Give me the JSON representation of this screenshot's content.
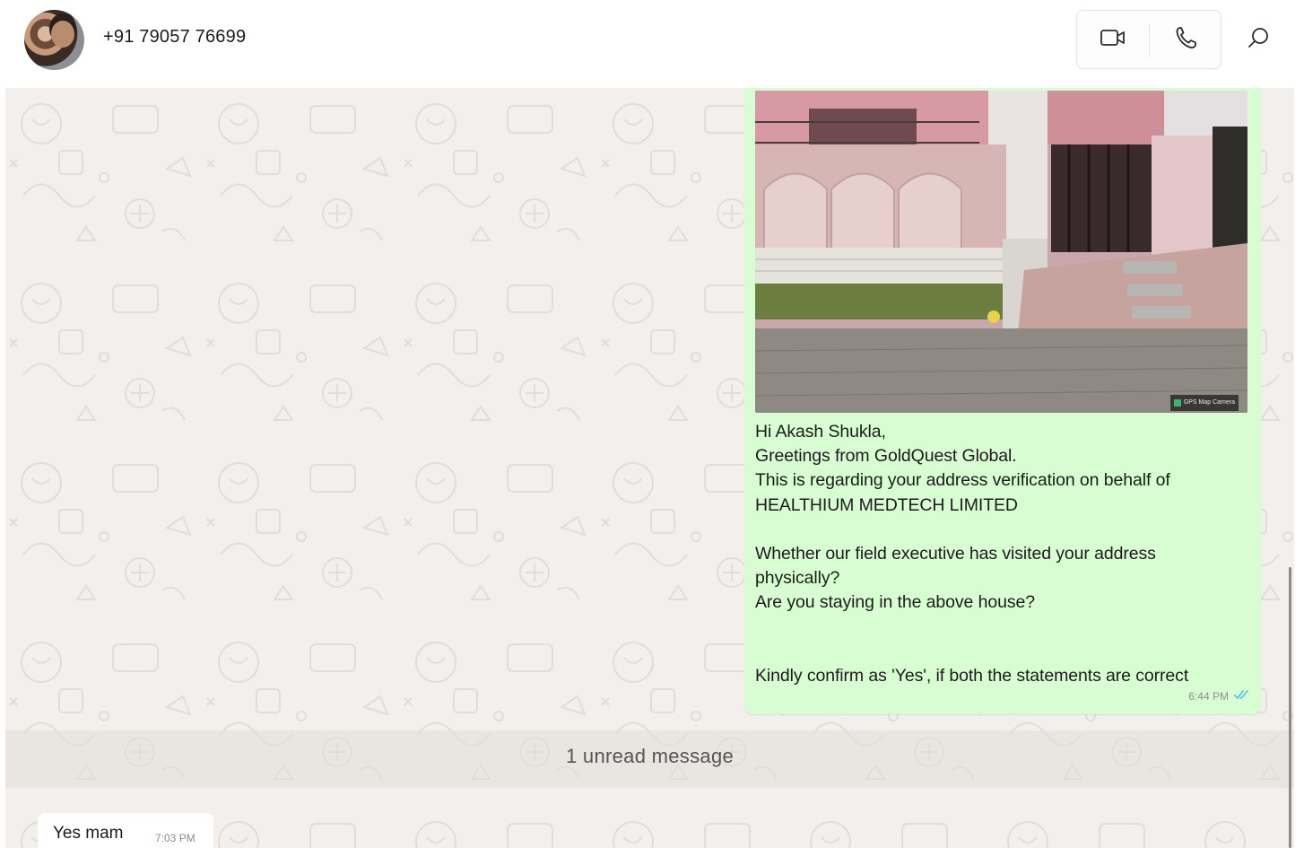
{
  "header": {
    "contact_name": "+91 79057 76699",
    "avatar_icon": "contact-avatar",
    "video_call_icon": "video-camera-icon",
    "voice_call_icon": "phone-icon",
    "search_icon": "search-icon"
  },
  "chat": {
    "outgoing_message": {
      "image_watermark": "GPS Map Camera",
      "lines": [
        "Hi Akash Shukla,",
        "Greetings from GoldQuest Global.",
        "This is regarding your address verification on behalf of",
        "HEALTHIUM MEDTECH LIMITED",
        "",
        "Whether our field executive has visited your address",
        "physically?",
        "Are you staying in the above house?",
        "",
        "",
        "Kindly confirm as 'Yes', if both the statements are correct"
      ],
      "time": "6:44 PM",
      "status_icon": "double-check-read-icon"
    },
    "unread_divider": "1 unread message",
    "incoming_message": {
      "text": "Yes mam",
      "time": "7:03 PM"
    }
  },
  "colors": {
    "outgoing_bubble": "#d9fdd3",
    "chat_background": "#f2efec",
    "read_tick": "#53bdeb"
  }
}
